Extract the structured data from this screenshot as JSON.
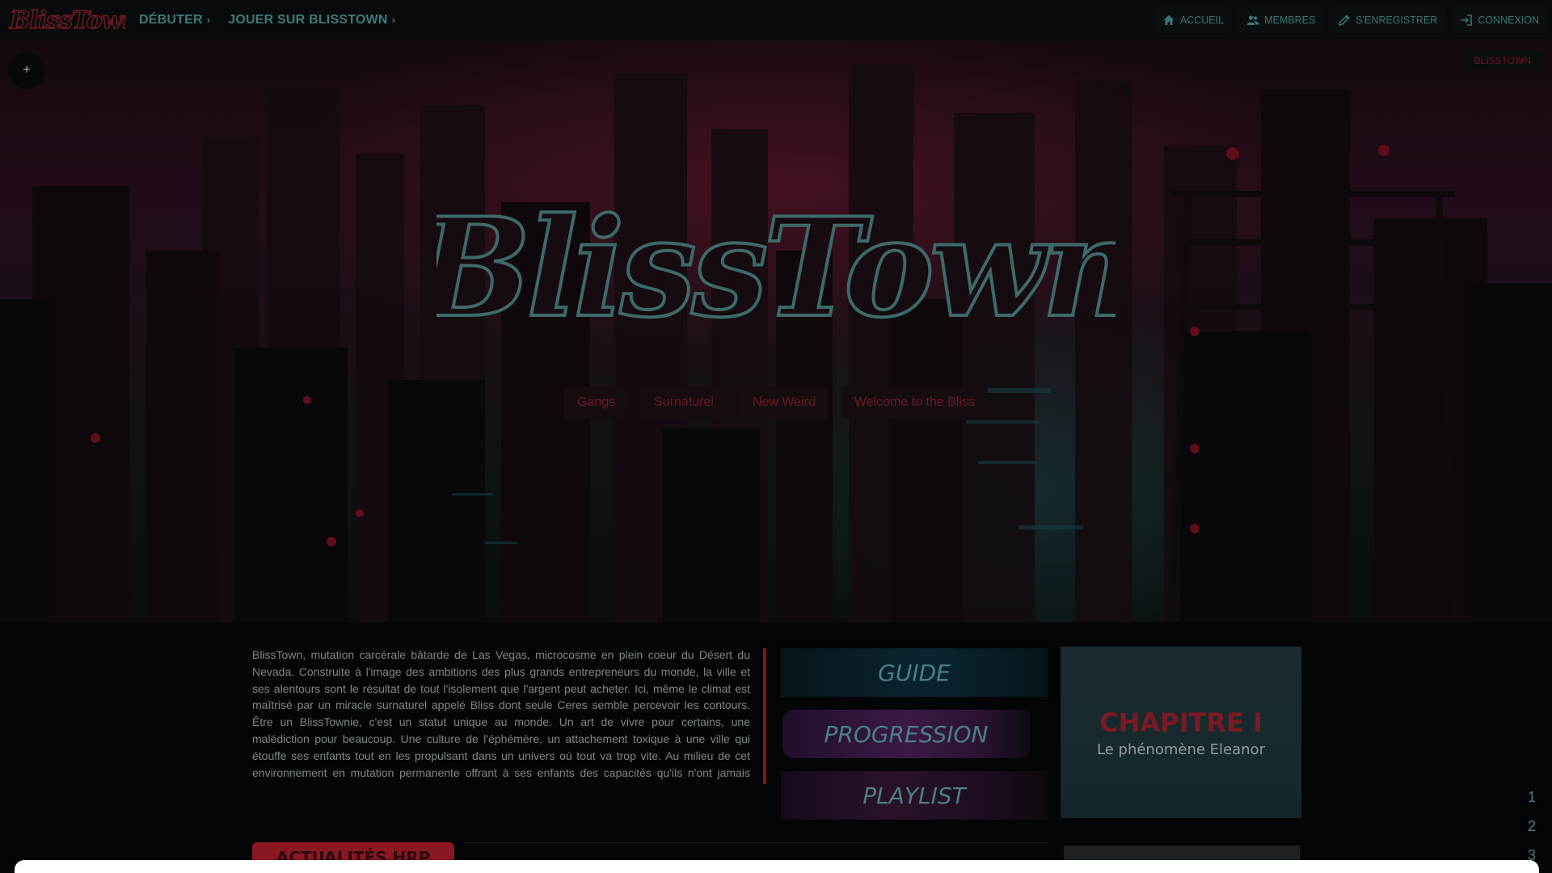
{
  "navbar": {
    "logo_text": "BlissTown",
    "left_menus": [
      {
        "label": "DÉBUTER",
        "icon": "chevron-right-icon"
      },
      {
        "label": "JOUER SUR BLISSTOWN",
        "icon": "chevron-right-icon"
      }
    ],
    "right_links": [
      {
        "label": "ACCUEIL",
        "icon": "home-icon"
      },
      {
        "label": "MEMBRES",
        "icon": "users-icon"
      },
      {
        "label": "S'ENREGISTRER",
        "icon": "pencil-icon"
      },
      {
        "label": "CONNEXION",
        "icon": "login-icon"
      }
    ]
  },
  "hero": {
    "toggle_label": "+",
    "site_tag": "BLISSTOWN",
    "logo_text": "BlissTown",
    "tags": [
      "Gangs",
      "Surnaturel",
      "New Weird",
      "Welcome to the Bliss"
    ]
  },
  "main": {
    "intro_text": "BlissTown, mutation carcérale bâtarde de Las Vegas, microcosme en plein coeur du Désert du Nevada. Construite à l'image des ambitions des plus grands entrepreneurs du monde, la ville et ses alentours sont le résultat de tout l'isolement que l'argent peut acheter. Ici, même le climat est maîtrisé par un miracle surnaturel appelé Bliss dont seule Ceres semble percevoir les contours. Être un BlissTownie, c'est un statut unique au monde. Un art de vivre pour certains, une malédiction pour beaucoup. Une culture de l'éphémère, un attachement toxique à une ville qui étouffe ses enfants tout en les propulsant dans un univers où tout va trop vite. Au milieu de cet environnement en mutation permanente offrant à ses enfants des capacités qu'ils n'ont jamais demandées s'affrontent les ambitions, les recherches de liberté et les soifs de vengeance. À chaque nouvel évènement étrange et parfois désastreux, les questions pleuvent. Pourquoi tout le",
    "menu_cards": [
      "GUIDE",
      "PROGRESSION",
      "PLAYLIST"
    ],
    "chapter": {
      "title": "CHAPITRE I",
      "subtitle": "Le phénomène Eleanor"
    },
    "pager": [
      "1",
      "2",
      "3"
    ],
    "news_button": "ACTUALITÉS HRP"
  },
  "colors": {
    "accent_red": "#8a1722",
    "accent_teal": "#3f7a79",
    "background": "#050607"
  }
}
